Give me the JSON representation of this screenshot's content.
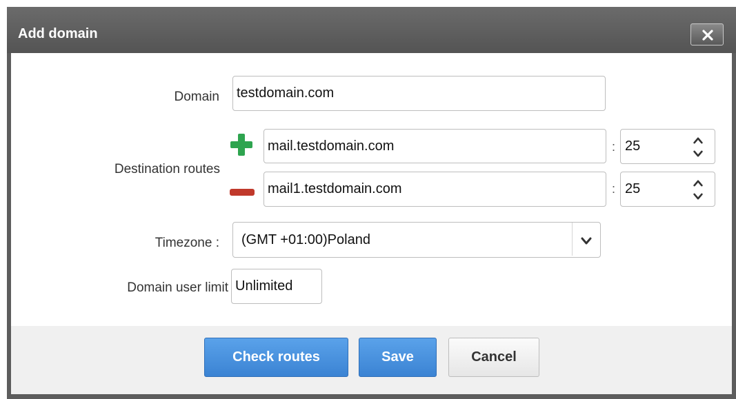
{
  "dialog": {
    "title": "Add domain",
    "close_icon": "close-icon"
  },
  "form": {
    "domain_label": "Domain",
    "domain_value": "testdomain.com",
    "routes_label": "Destination routes",
    "routes": [
      {
        "host": "mail.testdomain.com",
        "port": "25",
        "action_icon": "plus-icon"
      },
      {
        "host": "mail1.testdomain.com",
        "port": "25",
        "action_icon": "minus-icon"
      }
    ],
    "port_separator": ":",
    "timezone_label": "Timezone :",
    "timezone_value": "(GMT +01:00)Poland",
    "user_limit_label": "Domain user limit",
    "user_limit_value": "Unlimited"
  },
  "buttons": {
    "check_routes": "Check routes",
    "save": "Save",
    "cancel": "Cancel"
  },
  "colors": {
    "titlebar": "#5d5d5d",
    "primary_button": "#3b83d3",
    "add_icon": "#2ea44f",
    "remove_icon": "#c0392b"
  }
}
